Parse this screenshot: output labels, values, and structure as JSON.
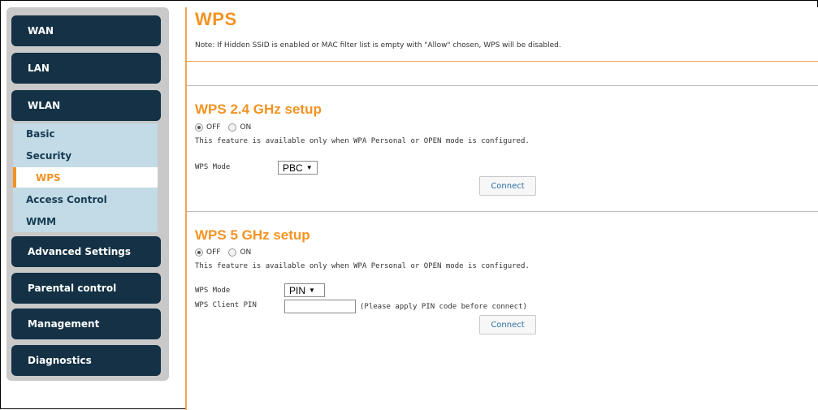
{
  "sidebar": {
    "main_items": [
      {
        "label": "WAN"
      },
      {
        "label": "LAN"
      },
      {
        "label": "WLAN"
      },
      {
        "label": "Advanced Settings"
      },
      {
        "label": "Parental control"
      },
      {
        "label": "Management"
      },
      {
        "label": "Diagnostics"
      }
    ],
    "wlan_subitems": [
      {
        "label": "Basic"
      },
      {
        "label": "Security"
      },
      {
        "label": "WPS",
        "active": true
      },
      {
        "label": "Access Control"
      },
      {
        "label": "WMM"
      }
    ]
  },
  "page": {
    "title": "WPS",
    "note": "Note: If Hidden SSID is enabled or MAC filter list is empty with \"Allow\" chosen, WPS will be disabled."
  },
  "wps24": {
    "title": "WPS 2.4 GHz setup",
    "off_label": "OFF",
    "on_label": "ON",
    "selected": "OFF",
    "feature_note": "This feature is available only when WPA Personal or OPEN mode is configured.",
    "mode_label": "WPS Mode",
    "mode_value": "PBC",
    "connect_label": "Connect"
  },
  "wps5": {
    "title": "WPS 5 GHz setup",
    "off_label": "OFF",
    "on_label": "ON",
    "selected": "OFF",
    "feature_note": "This feature is available only when WPA Personal or OPEN mode is configured.",
    "mode_label": "WPS Mode",
    "mode_value": "PIN",
    "client_pin_label": "WPS Client PIN",
    "client_pin_value": "",
    "pin_note": "(Please apply PIN code before connect)",
    "connect_label": "Connect"
  },
  "colors": {
    "accent": "#f39322",
    "nav_bg": "#143145",
    "subnav_bg": "#c2dbe6",
    "link": "#2a6fa3"
  }
}
